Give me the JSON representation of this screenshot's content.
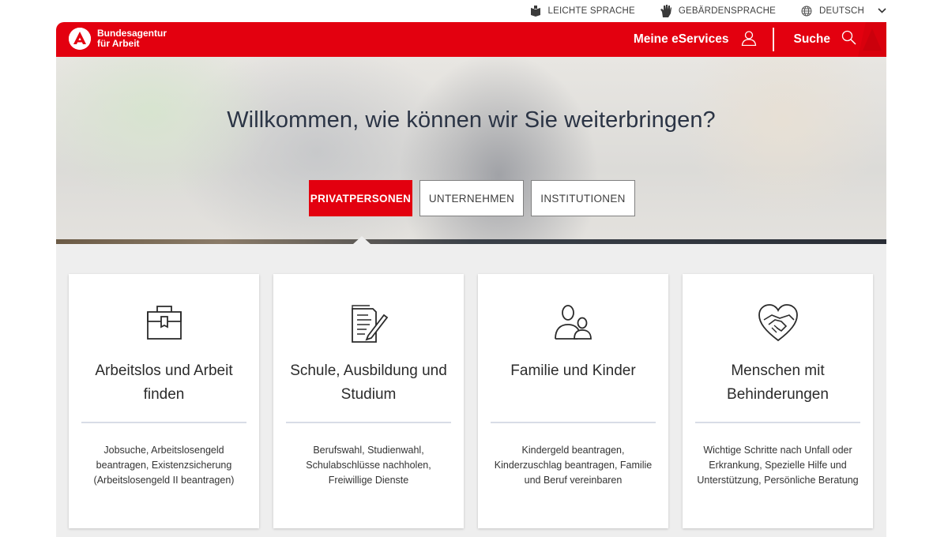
{
  "utility": {
    "easy_language": "LEICHTE SPRACHE",
    "sign_language": "GEBÄRDENSPRACHE",
    "language": "DEUTSCH"
  },
  "header": {
    "brand_line1": "Bundesagentur",
    "brand_line2": "für Arbeit",
    "eservices": "Meine eServices",
    "search": "Suche",
    "color": "#e3000f"
  },
  "hero": {
    "title": "Willkommen, wie können wir Sie weiterbringen?",
    "tabs": [
      {
        "label": "PRIVATPERSONEN",
        "active": true
      },
      {
        "label": "UNTERNEHMEN",
        "active": false
      },
      {
        "label": "INSTITUTIONEN",
        "active": false
      }
    ]
  },
  "cards": [
    {
      "icon": "briefcase-icon",
      "title": "Arbeitslos und Arbeit finden",
      "description": "Jobsuche, Arbeitslosengeld beantragen, Existenzsicherung (Arbeitslosengeld II beantragen)"
    },
    {
      "icon": "document-pen-icon",
      "title": "Schule, Ausbildung und Studium",
      "description": "Berufswahl, Studienwahl, Schulabschlüsse nachholen, Freiwillige Dienste"
    },
    {
      "icon": "family-icon",
      "title": "Familie und Kinder",
      "description": "Kindergeld beantragen, Kinderzuschlag beantragen, Familie und Beruf vereinbaren"
    },
    {
      "icon": "heart-handshake-icon",
      "title": "Menschen mit Behinderungen",
      "description": "Wichtige Schritte nach Unfall oder Erkrankung, Spezielle Hilfe und Unterstützung, Persönliche Beratung"
    }
  ]
}
